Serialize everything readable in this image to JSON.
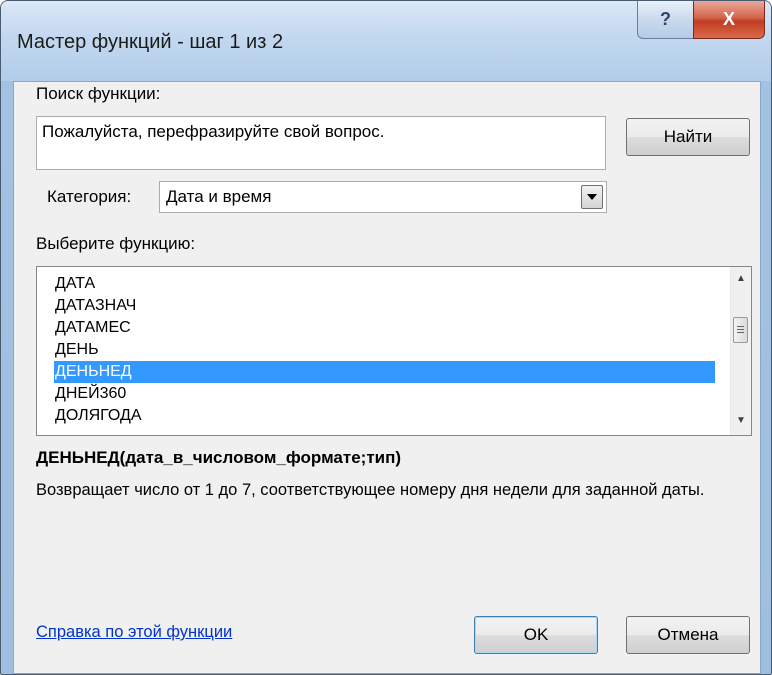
{
  "window": {
    "title": "Мастер функций - шаг 1 из 2",
    "help_glyph": "?",
    "close_glyph": "X"
  },
  "search": {
    "label": "Поиск функции:",
    "query": "Пожалуйста, перефразируйте свой вопрос.",
    "find_label": "Найти"
  },
  "category": {
    "label": "Категория:",
    "selected": "Дата и время"
  },
  "functions": {
    "label": "Выберите функцию:",
    "items": [
      "ДАТА",
      "ДАТАЗНАЧ",
      "ДАТАМЕС",
      "ДЕНЬ",
      "ДЕНЬНЕД",
      "ДНЕЙ360",
      "ДОЛЯГОДА"
    ],
    "selected_index": 4
  },
  "details": {
    "signature": "ДЕНЬНЕД(дата_в_числовом_формате;тип)",
    "description": "Возвращает число от 1 до 7, соответствующее номеру дня недели для заданной даты."
  },
  "footer": {
    "help_link": "Справка по этой функции",
    "ok_label": "OK",
    "cancel_label": "Отмена"
  },
  "colors": {
    "selection": "#3399ff",
    "link": "#0033cc",
    "close_button": "#c13c22"
  }
}
